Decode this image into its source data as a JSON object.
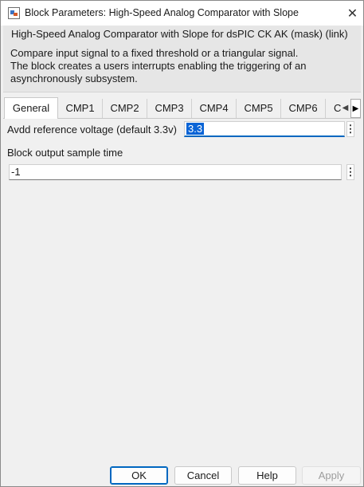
{
  "window": {
    "title": "Block Parameters: High-Speed Analog Comparator with Slope",
    "close_glyph": "✕"
  },
  "mask": {
    "title": "High-Speed Analog Comparator with Slope for dsPIC CK  AK (mask) (link)",
    "description_lines": [
      "Compare input signal to a fixed threshold or a triangular signal.",
      "The block creates a users interrupts enabling the triggering of an",
      "asynchronously subsystem."
    ]
  },
  "tabs": [
    {
      "label": "General",
      "active": true
    },
    {
      "label": "CMP1",
      "active": false
    },
    {
      "label": "CMP2",
      "active": false
    },
    {
      "label": "CMP3",
      "active": false
    },
    {
      "label": "CMP4",
      "active": false
    },
    {
      "label": "CMP5",
      "active": false
    },
    {
      "label": "CMP6",
      "active": false
    },
    {
      "label": "C",
      "active": false
    }
  ],
  "tab_scroll": {
    "left": "◀",
    "right": "▶"
  },
  "params": {
    "avdd": {
      "label": "Avdd reference voltage (default 3.3v)",
      "value": "3.3"
    },
    "sample_time": {
      "label": "Block output sample time",
      "value": "-1"
    },
    "menu_glyph": "⋮"
  },
  "buttons": {
    "ok": "OK",
    "cancel": "Cancel",
    "help": "Help",
    "apply": "Apply"
  },
  "colors": {
    "selection": "#0a64d6",
    "focus_accent": "#0067c0",
    "dialog_bg": "#f0f0f0"
  },
  "icons": {
    "app": "simulink-block-icon",
    "close": "close-icon",
    "tab_left": "chevron-left-icon",
    "tab_right": "chevron-right-icon",
    "param_menu": "kebab-menu-icon"
  }
}
